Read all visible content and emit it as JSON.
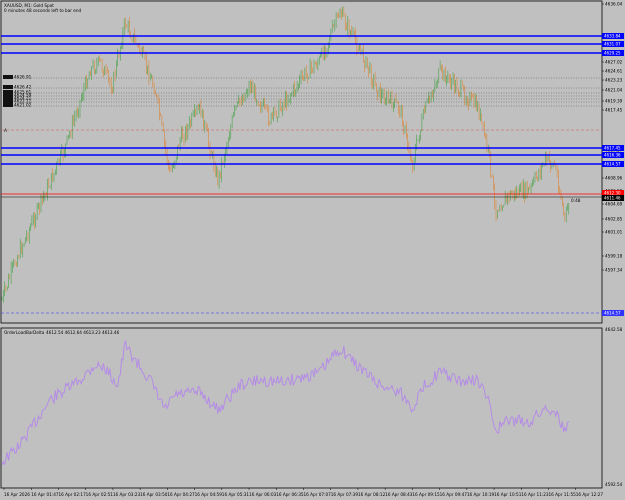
{
  "chart": {
    "symbol": "XAUUSD, M1: Gold Spot",
    "timer": "0 minutes 48 seconds left to bar end",
    "timer_right": "0:48",
    "level_marker": "A",
    "colors": {
      "background": "#c0c0c0",
      "bull_candle": "#2e9b2e",
      "bear_candle": "#e07a1a",
      "level_line": "#0000ff",
      "indicator": "#b48ce6",
      "red_line": "#ff0000"
    }
  },
  "levels": [
    "4633.84",
    "4631.07",
    "4629.25",
    "4617.45",
    "4616.36",
    "4614.57"
  ],
  "objects": [
    "4626.91",
    "4626.42",
    "4625.61",
    "4624.59",
    "4624.21",
    "4622.11",
    "4621.02"
  ],
  "price_axis": {
    "ticks": [
      "4636.04",
      "4633.84",
      "4631.07",
      "4629.25",
      "4627.02",
      "4624.61",
      "4623.23",
      "4621.04",
      "4619.39",
      "4617.45",
      "4616.36",
      "4614.57",
      "4612.48",
      "4610.46",
      "4608.96",
      "4606.52",
      "4604.69",
      "4602.85",
      "4601.01",
      "4599.18",
      "4597.34"
    ],
    "current_price": "4611.46",
    "red_level": "4612.30"
  },
  "indicator": {
    "name": "OrderLoadBarDelta",
    "values": "4612.54  4612.64  4613.23  4613.46",
    "axis_top": "4642.58",
    "axis_bottom": "4592.54"
  },
  "time_axis": [
    "16 Apr 2026",
    "16 Apr 01:47",
    "16 Apr 02:17",
    "16 Apr 02:51",
    "16 Apr 03:23",
    "16 Apr 03:50",
    "16 Apr 04:27",
    "16 Apr 04:59",
    "16 Apr 05:31",
    "16 Apr 06:03",
    "16 Apr 06:35",
    "16 Apr 07:07",
    "16 Apr 07:39",
    "16 Apr 08:12",
    "16 Apr 08:43",
    "16 Apr 09:15",
    "16 Apr 09:47",
    "16 Apr 10:19",
    "16 Apr 10:51",
    "16 Apr 11:23",
    "16 Apr 11:55",
    "16 Apr 12:27"
  ]
}
